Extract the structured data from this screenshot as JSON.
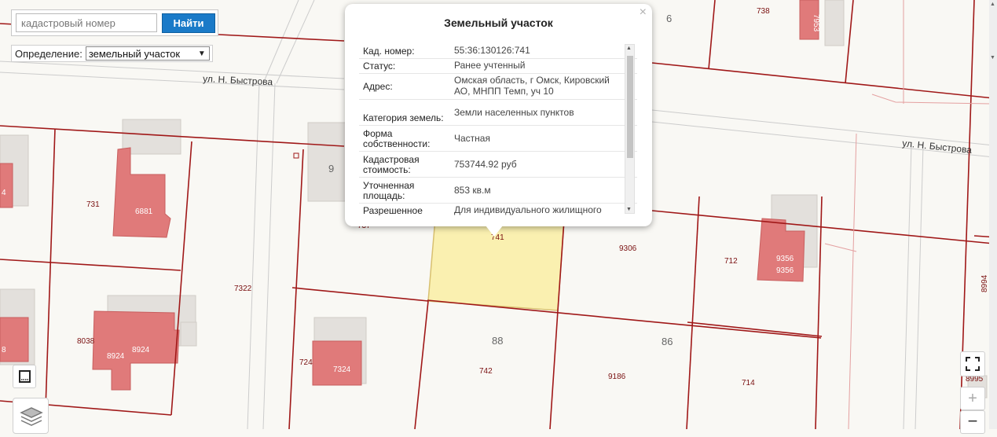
{
  "search": {
    "placeholder": "кадастровый номер",
    "button_label": "Найти"
  },
  "definition": {
    "label": "Определение:",
    "selected": "земельный участок"
  },
  "popup": {
    "title": "Земельный участок",
    "close": "×",
    "rows": [
      {
        "key": "Кад. номер:",
        "value": "55:36:130126:741"
      },
      {
        "key": "Статус:",
        "value": "Ранее учтенный"
      },
      {
        "key": "Адрес:",
        "value": "Омская область, г Омск, Кировский АО, МНПП Темп, уч 10"
      },
      {
        "key": "Категория земель:",
        "value": "Земли населенных пунктов"
      },
      {
        "key": "Форма собственности:",
        "value": "Частная"
      },
      {
        "key": "Кадастровая стоимость:",
        "value": "753744.92 руб"
      },
      {
        "key": "Уточненная площадь:",
        "value": "853 кв.м"
      },
      {
        "key": "Разрешенное",
        "value": "Для индивидуального жилищного"
      }
    ]
  },
  "map": {
    "streets": {
      "top_left": "ул. Н. Быстрова",
      "right": "ул. Н. Быстрова"
    },
    "cadastral_labels": {
      "n738": "738",
      "n731": "731",
      "n7322": "7322",
      "n8038": "8038",
      "n724": "724",
      "n741": "741",
      "n742": "742",
      "n9306": "9306",
      "n712": "712",
      "n9186": "9186",
      "n714": "714",
      "n8994": "8994",
      "n8995": "8995",
      "n737": "737"
    },
    "building_labels": {
      "b6881": "6881",
      "b7953": "7953",
      "b8924a": "8924",
      "b8924b": "8924",
      "b7324": "7324",
      "b9356a": "9356",
      "b9356b": "9356",
      "b4": "4",
      "b8": "8"
    },
    "block_numbers": {
      "q6": "6",
      "q9": "9",
      "q88": "88",
      "q86": "86"
    }
  },
  "controls": {
    "zoom_in": "+",
    "zoom_out": "−"
  },
  "icons": {
    "legend": "legend-icon",
    "layers": "layers-icon",
    "fullscreen": "fullscreen-icon",
    "close": "close-icon"
  },
  "colors": {
    "parcel_border": "#a01818",
    "building": "#e07a7a",
    "selected_parcel": "#faf0b0",
    "button": "#1a7ac8"
  }
}
